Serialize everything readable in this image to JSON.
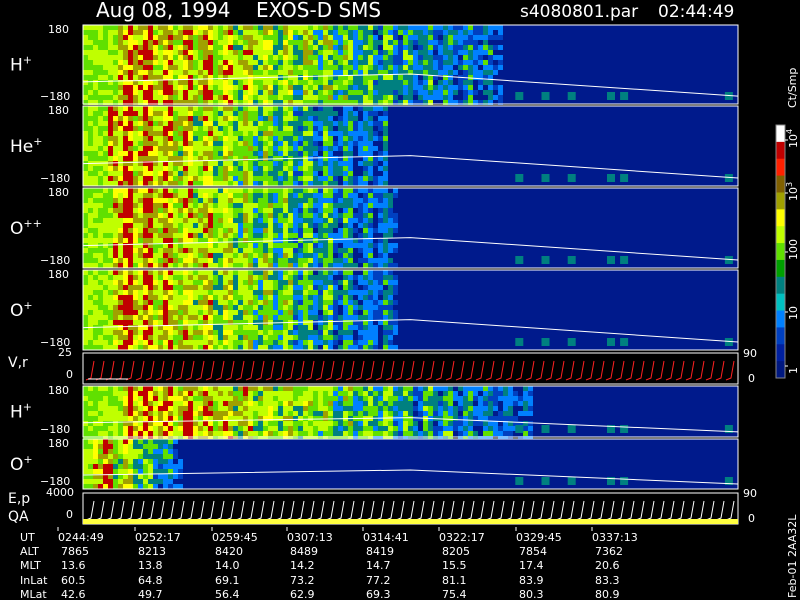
{
  "header": {
    "date": "Aug 08, 1994",
    "instrument": "EXOS-D SMS",
    "file": "s4080801.par",
    "time": "02:44:49"
  },
  "colorbar": {
    "unit_label": "Ct/Smp",
    "ticks": [
      "10",
      "100",
      "10",
      "10",
      "1"
    ],
    "tick_exponents": [
      "4",
      "",
      "3",
      "",
      ""
    ],
    "tick_values": [
      10000,
      100,
      1000,
      10,
      1
    ],
    "colors": [
      "#ffffff",
      "#c00000",
      "#ff2000",
      "#806000",
      "#a0a000",
      "#ffff00",
      "#c0ff00",
      "#60e000",
      "#00a000",
      "#008080",
      "#00c0c0",
      "#0080ff",
      "#0040c0",
      "#0020a0",
      "#001880"
    ]
  },
  "chart_data": {
    "type": "heatmap",
    "panels": [
      {
        "ion": "H",
        "charge": "+",
        "y_top": "180",
        "y_bottom": "−180",
        "ylim": [
          -180,
          180
        ],
        "activity_end": 0.64
      },
      {
        "ion": "He",
        "charge": "+",
        "y_top": "180",
        "y_bottom": "−180",
        "ylim": [
          -180,
          180
        ],
        "activity_end": 0.46
      },
      {
        "ion": "O",
        "charge": "++",
        "y_top": "180",
        "y_bottom": "−180",
        "ylim": [
          -180,
          180
        ],
        "activity_end": 0.48
      },
      {
        "ion": "O",
        "charge": "+",
        "y_top": "180",
        "y_bottom": "−180",
        "ylim": [
          -180,
          180
        ],
        "activity_end": 0.48
      },
      {
        "ion": "H",
        "charge": "+",
        "y_top": "180",
        "y_bottom": "−180",
        "ylim": [
          -180,
          180
        ],
        "activity_end": 0.68
      },
      {
        "ion": "O",
        "charge": "+",
        "y_top": "180",
        "y_bottom": "−180",
        "ylim": [
          -180,
          180
        ],
        "activity_end": 0.15
      }
    ],
    "line_panels": [
      {
        "label": "V,r",
        "y_top": "25",
        "y_zero": "0",
        "right_top": "90",
        "right_bottom": "0"
      },
      {
        "label_top": "E,p",
        "label_bottom": "QA",
        "y_top": "4000",
        "y_zero": "0",
        "right_top": "90",
        "right_bottom": "0"
      }
    ],
    "time_axis": {
      "row_labels": [
        "UT",
        "ALT",
        "MLT",
        "InLat",
        "MLat"
      ],
      "columns": [
        [
          "0244:49",
          "7865",
          "13.6",
          "60.5",
          "42.6"
        ],
        [
          "0252:17",
          "8213",
          "13.8",
          "64.8",
          "49.7"
        ],
        [
          "0259:45",
          "8420",
          "14.0",
          "69.1",
          "56.4"
        ],
        [
          "0307:13",
          "8489",
          "14.2",
          "73.2",
          "62.9"
        ],
        [
          "0314:41",
          "8419",
          "14.7",
          "77.2",
          "69.3"
        ],
        [
          "0322:17",
          "8205",
          "15.5",
          "81.1",
          "75.4"
        ],
        [
          "0329:45",
          "7854",
          "17.4",
          "83.9",
          "80.3"
        ],
        [
          "0337:13",
          "7362",
          "20.6",
          "83.3",
          "80.9"
        ]
      ]
    }
  },
  "footer": {
    "stamp": "Feb-01 2AA32L"
  }
}
